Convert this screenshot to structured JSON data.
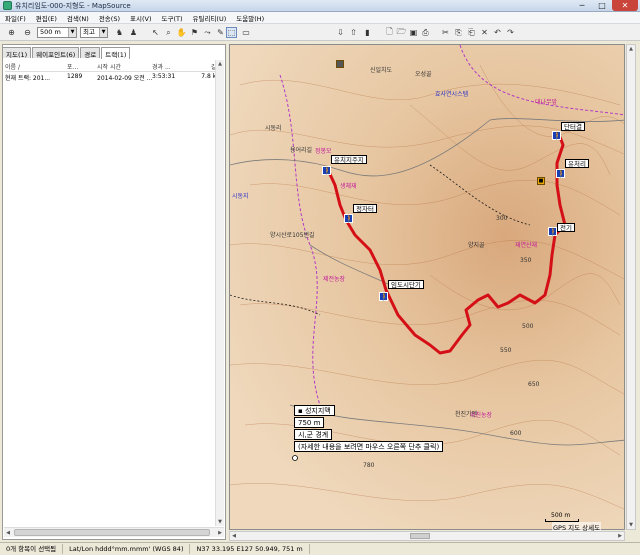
{
  "window": {
    "title": "유치리임도-000-지형도 - MapSource",
    "minimize": "─",
    "maximize": "□",
    "close": "✕"
  },
  "menu": [
    "파일(F)",
    "편집(E)",
    "검색(N)",
    "전송(S)",
    "표시(V)",
    "도구(T)",
    "유틸리티(U)",
    "도움말(H)"
  ],
  "toolbar": {
    "zoom_value": "500 m",
    "detail_value": "최고"
  },
  "tabs": [
    "지도(1)",
    "웨이포인트(6)",
    "경로",
    "트랙(1)"
  ],
  "active_tab": 3,
  "track_list": {
    "headers": [
      "이름 /",
      "포...",
      "시작 시간",
      "경과 ...",
      "길이"
    ],
    "rows": [
      [
        "현재 트랙: 201...",
        "1289",
        "2014-02-09 오전 ...",
        "3:53:31",
        "7.8 km"
      ]
    ]
  },
  "waypoints": {
    "w1": "유치지주지",
    "w2": "정자터",
    "w3": "임도시단기",
    "w4": "단터결",
    "w5": "유처리",
    "w6": "전기"
  },
  "map_labels": {
    "l1": "용어리길",
    "l2": "정봉모",
    "l3": "시동리",
    "l4": "시동지",
    "l5": "생체재",
    "l6": "양지골",
    "l7": "재연산재",
    "l8": "제전농장",
    "l9": "천진기멘",
    "l10": "300",
    "l11": "350",
    "l12": "500",
    "l13": "550",
    "l14": "650",
    "l15": "600",
    "l16": "780",
    "l17": "신일치도",
    "l18": "오성골",
    "l19": "효사연시스템",
    "l20": "위친농장",
    "l21": "양시산로105번길",
    "l22": "대나무앞"
  },
  "tooltip": {
    "name": "성지지맥",
    "distance": "750 m",
    "type": "시,군 경계",
    "hint": "(자세한 내용을 보려면 마우스 오른쪽 단추 클릭)"
  },
  "scale_label": "500 m",
  "map_footer": "GPS 지도 상세도",
  "status": {
    "selection": "0개 항목이 선택됨",
    "coord_format": "Lat/Lon hddd°mm.mmm' (WGS 84)",
    "position": "N37 33.195 E127 50.949, 751 m"
  }
}
